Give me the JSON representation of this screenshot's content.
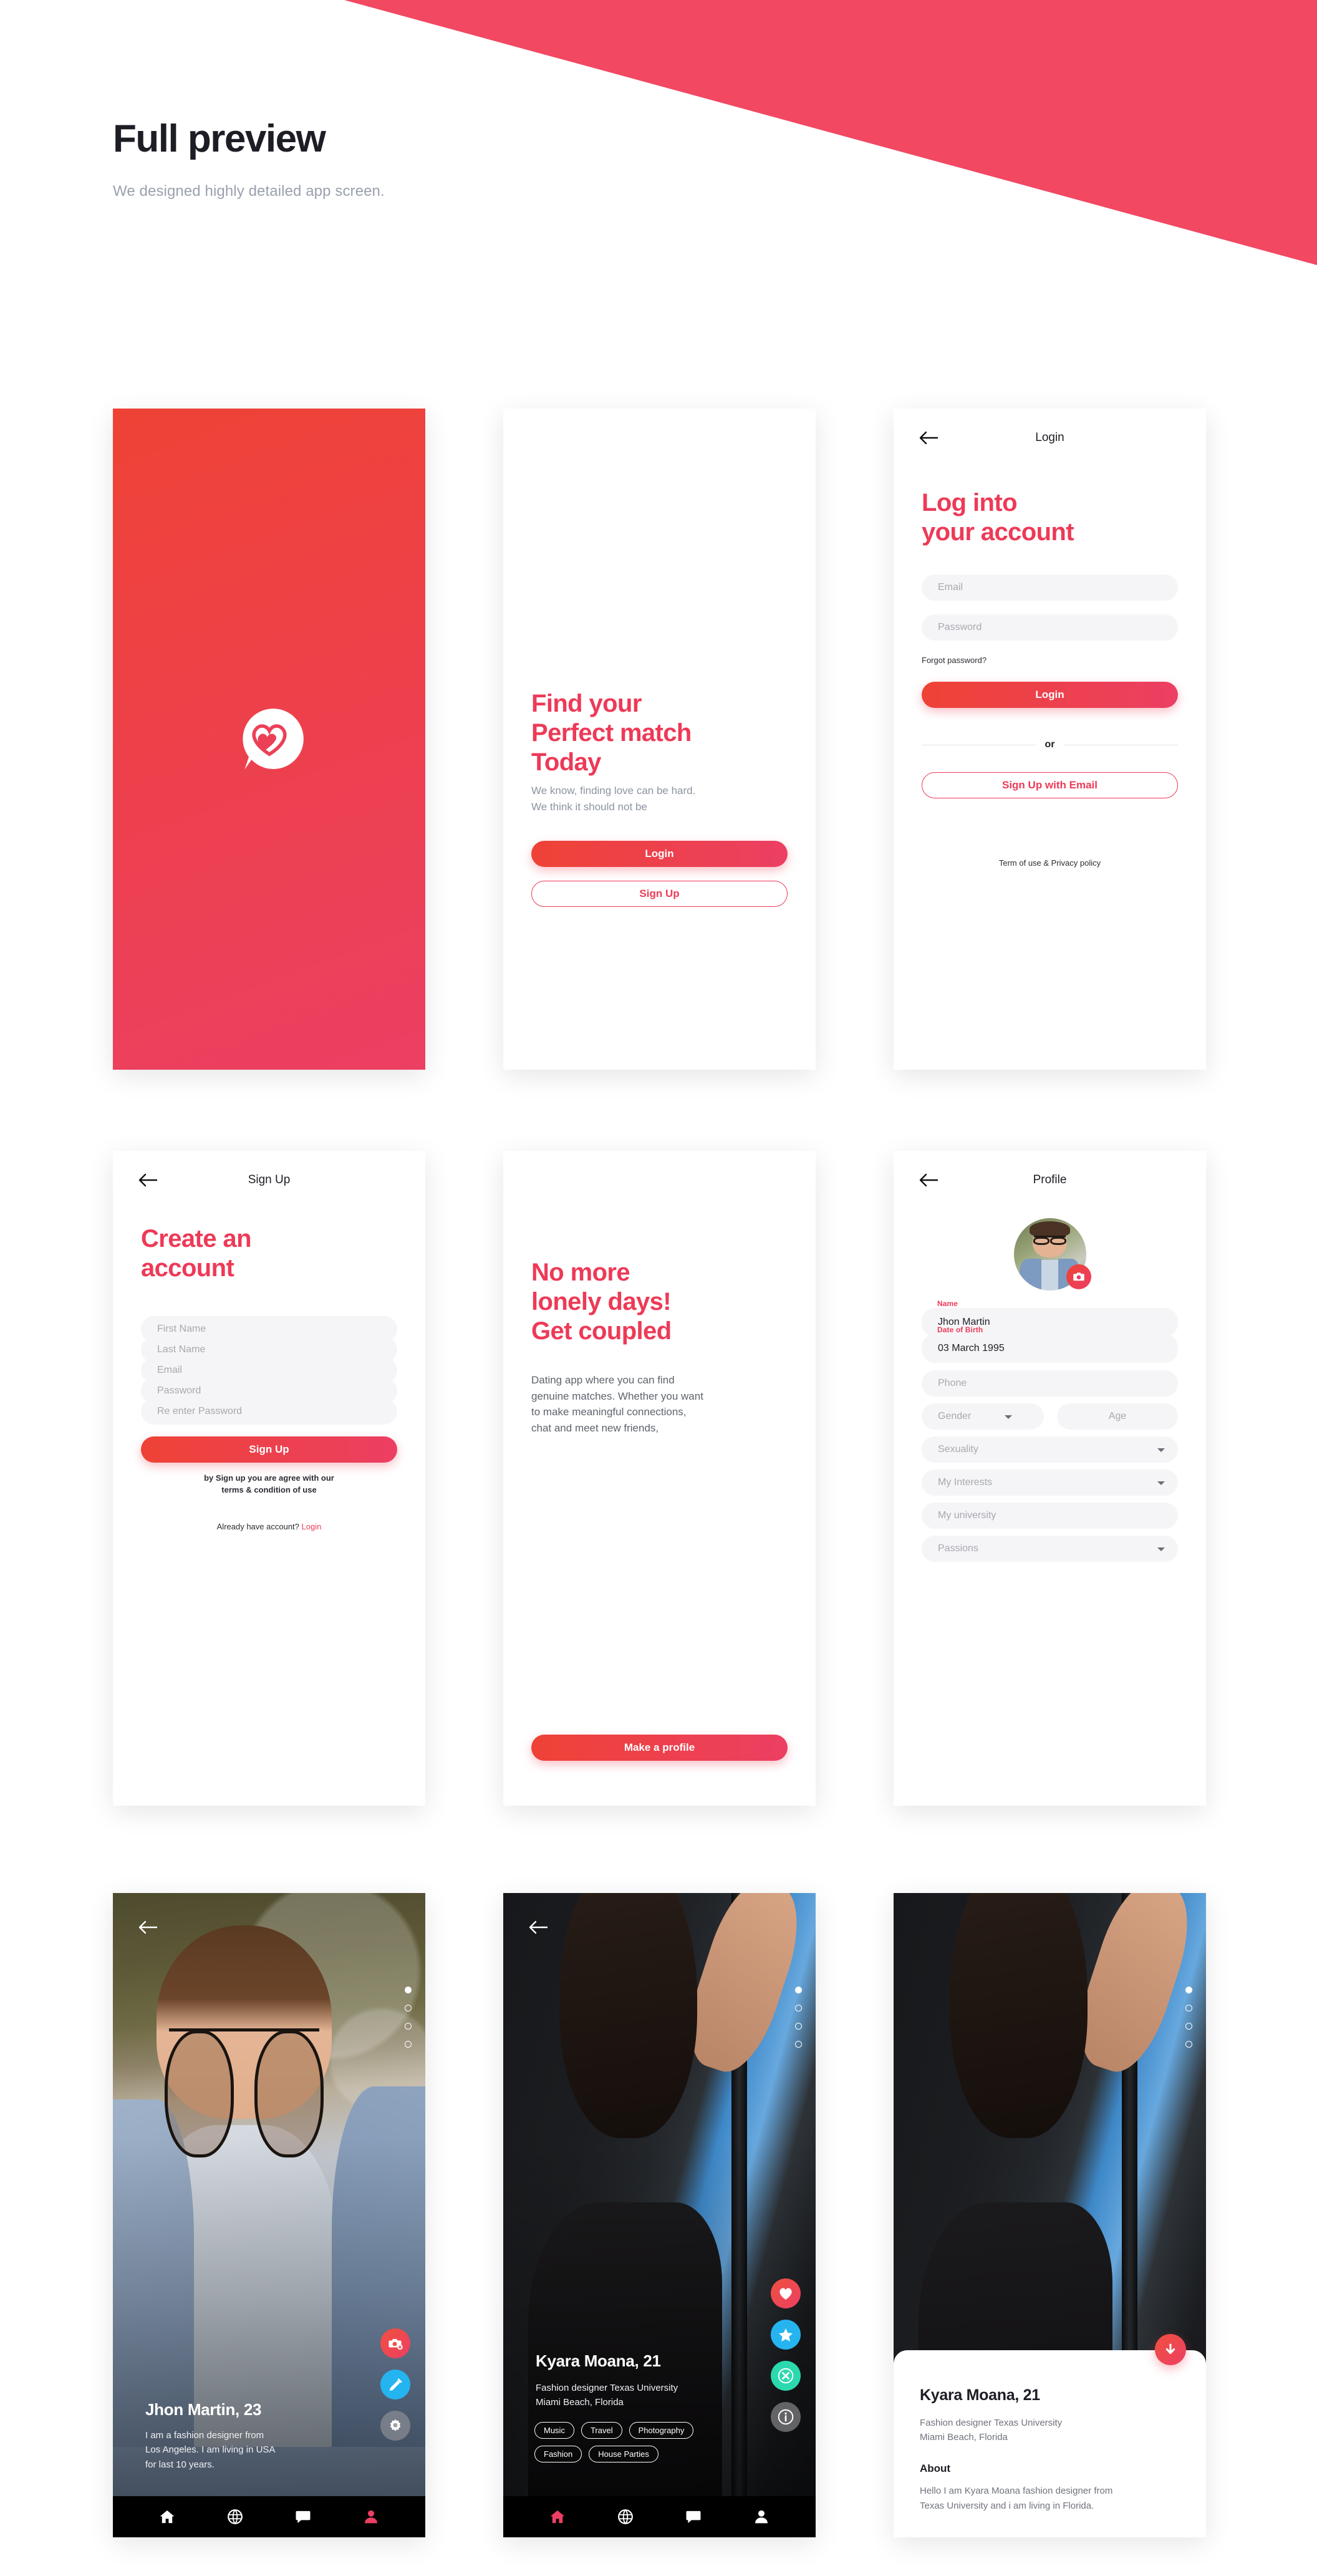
{
  "header": {
    "title": "Full preview",
    "subtitle": "We designed highly detailed app screen.",
    "accent": "#F24862"
  },
  "theme": {
    "primary_start": "#EE4236",
    "primary_end": "#EC3F63",
    "heading_red": "#ED3A57",
    "muted": "#8C93A0",
    "field_bg": "#F5F5F7",
    "blue": "#25B4F0",
    "green": "#2BD9AE"
  },
  "screens": {
    "splash": {
      "name": "splash-screen",
      "logo_icon": "heart-chat-bubble-icon"
    },
    "onboarding": {
      "heading": "Find your\nPerfect match\nToday",
      "body": "We know, finding love can be hard.\nWe think it should not be",
      "primary_button": "Login",
      "secondary_button": "Sign Up"
    },
    "login": {
      "topbar_title": "Login",
      "back_icon": "arrow-left-icon",
      "heading": "Log into\nyour account",
      "fields": [
        {
          "name": "email-field",
          "placeholder": "Email"
        },
        {
          "name": "password-field",
          "placeholder": "Password"
        }
      ],
      "forgot_link": "Forgot  password?",
      "primary_button": "Login",
      "divider_text": "or",
      "secondary_button": "Sign Up with Email",
      "footer": "Term of use & Privacy policy"
    },
    "signup": {
      "topbar_title": "Sign Up",
      "back_icon": "arrow-left-icon",
      "heading": "Create an\naccount",
      "fields": [
        {
          "name": "first-name-field",
          "placeholder": "First Name"
        },
        {
          "name": "last-name-field",
          "placeholder": "Last Name"
        },
        {
          "name": "email-field",
          "placeholder": "Email"
        },
        {
          "name": "password-field",
          "placeholder": "Password"
        },
        {
          "name": "reenter-password-field",
          "placeholder": "Re enter Password"
        }
      ],
      "primary_button": "Sign Up",
      "terms_note": "by Sign up you are agree with our\nterms & condition of use",
      "login_prompt": "Already have account?",
      "login_link": "Login"
    },
    "intro": {
      "heading": "No more\nlonely days!\nGet coupled",
      "body": "Dating app where you can find\ngenuine matches. Whether you want\nto make meaningful connections,\nchat and meet new friends,",
      "primary_button": "Make a profile"
    },
    "profile": {
      "topbar_title": "Profile",
      "back_icon": "arrow-left-icon",
      "camera_icon": "camera-icon",
      "avatar_alt": "user-avatar",
      "fields": [
        {
          "name": "name-field",
          "label": "Name",
          "value": "Jhon Martin",
          "type": "value"
        },
        {
          "name": "dob-field",
          "label": "Date of Birth",
          "value": "03 March 1995",
          "type": "value"
        },
        {
          "name": "phone-field",
          "placeholder": "Phone",
          "type": "text"
        },
        {
          "name": "gender-field",
          "placeholder": "Gender",
          "type": "select"
        },
        {
          "name": "age-field",
          "placeholder": "Age",
          "type": "text"
        },
        {
          "name": "sexuality-field",
          "placeholder": "Sexuality",
          "type": "select"
        },
        {
          "name": "interests-field",
          "placeholder": "My Interests",
          "type": "select"
        },
        {
          "name": "university-field",
          "placeholder": "My university",
          "type": "text"
        },
        {
          "name": "passions-field",
          "placeholder": "Passions",
          "type": "select"
        }
      ]
    },
    "card_jhon": {
      "back_icon": "arrow-left-icon",
      "name": "Jhon Martin, 23",
      "description": "I am a fashion designer from\nLos Angeles. I am living in USA\nfor last 10 years.",
      "dots": {
        "total": 4,
        "active": 0
      },
      "fabs": [
        {
          "name": "add-photo-button",
          "icon": "camera-plus-icon",
          "color": "red"
        },
        {
          "name": "edit-profile-button",
          "icon": "pencil-icon",
          "color": "blue"
        },
        {
          "name": "settings-button",
          "icon": "gear-icon",
          "color": "grey"
        }
      ],
      "nav": [
        {
          "name": "nav-home",
          "icon": "home-icon",
          "active": false
        },
        {
          "name": "nav-explore",
          "icon": "globe-icon",
          "active": false
        },
        {
          "name": "nav-chat",
          "icon": "chat-icon",
          "active": false
        },
        {
          "name": "nav-profile",
          "icon": "person-icon",
          "active": true
        }
      ]
    },
    "card_kyara": {
      "back_icon": "arrow-left-icon",
      "name": "Kyara Moana, 21",
      "description": "Fashion designer Texas University\nMiami Beach, Florida",
      "tags": [
        "Music",
        "Travel",
        "Photography",
        "Fashion",
        "House Parties"
      ],
      "dots": {
        "total": 4,
        "active": 0
      },
      "fabs": [
        {
          "name": "like-button",
          "icon": "heart-icon",
          "color": "red"
        },
        {
          "name": "superlike-button",
          "icon": "star-icon",
          "color": "blue"
        },
        {
          "name": "dislike-button",
          "icon": "close-circle-icon",
          "color": "green"
        },
        {
          "name": "info-button",
          "icon": "info-icon",
          "color": "grey"
        }
      ],
      "nav": [
        {
          "name": "nav-home",
          "icon": "home-icon",
          "active": true
        },
        {
          "name": "nav-explore",
          "icon": "globe-icon",
          "active": false
        },
        {
          "name": "nav-chat",
          "icon": "chat-icon",
          "active": false
        },
        {
          "name": "nav-profile",
          "icon": "person-icon",
          "active": false
        }
      ]
    },
    "card_about": {
      "dots": {
        "total": 4,
        "active": 0
      },
      "collapse_icon": "arrow-down-icon",
      "name": "Kyara Moana, 21",
      "subtitle": "Fashion designer Texas University\nMiami Beach, Florida",
      "about_heading": "About",
      "about_body": "Hello I am Kyara Moana fashion designer from\nTexas University and i am living in Florida."
    }
  }
}
